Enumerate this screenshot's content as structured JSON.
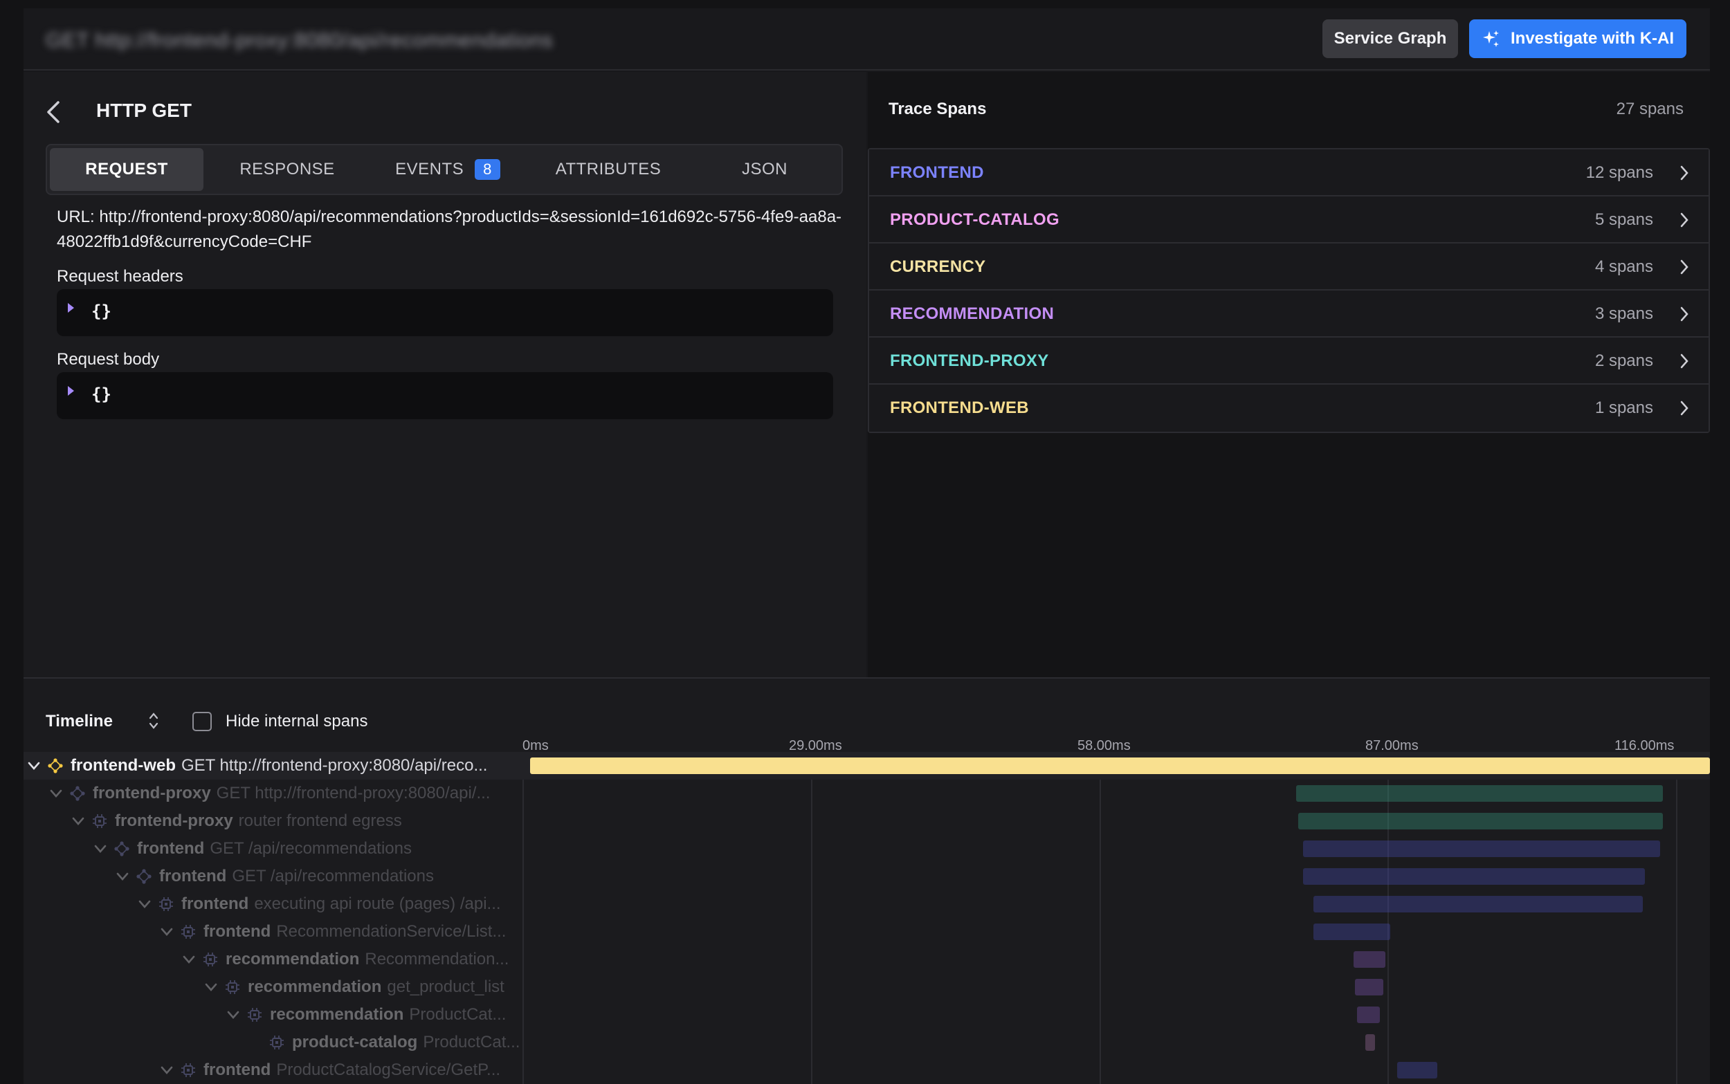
{
  "topbar": {
    "title": "GET http://frontend-proxy:8080/api/recommendations",
    "service_graph_label": "Service Graph",
    "investigate_label": "Investigate with K-AI",
    "accent_color": "#2f7cf6"
  },
  "detail": {
    "title": "HTTP GET",
    "tabs": [
      {
        "label": "REQUEST"
      },
      {
        "label": "RESPONSE"
      },
      {
        "label": "EVENTS",
        "count": "8"
      },
      {
        "label": "ATTRIBUTES"
      },
      {
        "label": "JSON"
      }
    ],
    "url_text": "URL: http://frontend-proxy:8080/api/recommendations?productIds=&sessionId=161d692c-5756-4fe9-aa8a-48022ffb1d9f&currencyCode=CHF",
    "request_headers_label": "Request headers",
    "request_headers_value": "{}",
    "request_body_label": "Request body",
    "request_body_value": "{}"
  },
  "trace_spans": {
    "title": "Trace Spans",
    "total": "27 spans",
    "services": [
      {
        "name": "FRONTEND",
        "count": "12 spans",
        "color": "#7c83ff"
      },
      {
        "name": "PRODUCT-CATALOG",
        "count": "5 spans",
        "color": "#f0a0f0"
      },
      {
        "name": "CURRENCY",
        "count": "4 spans",
        "color": "#f4e3a4"
      },
      {
        "name": "RECOMMENDATION",
        "count": "3 spans",
        "color": "#c48ef5"
      },
      {
        "name": "FRONTEND-PROXY",
        "count": "2 spans",
        "color": "#6fe0d8"
      },
      {
        "name": "FRONTEND-WEB",
        "count": "1 spans",
        "color": "#f6dc8e"
      }
    ]
  },
  "timeline": {
    "title": "Timeline",
    "hide_internal_label": "Hide internal spans",
    "ticks": [
      "0ms",
      "29.00ms",
      "58.00ms",
      "87.00ms",
      "116.00ms"
    ],
    "spans": [
      {
        "service": "frontend-web",
        "op": "GET http://frontend-proxy:8080/api/reco...",
        "depth": 0,
        "color": "#f9e08f",
        "start": 0.0,
        "end": 1.0,
        "icon": "network-icon",
        "chevron": true
      },
      {
        "service": "frontend-proxy",
        "op": "GET http://frontend-proxy:8080/api/...",
        "depth": 1,
        "color": "#3aa88a",
        "start": 0.649,
        "end": 0.96,
        "icon": "network-icon",
        "chevron": true
      },
      {
        "service": "frontend-proxy",
        "op": "router frontend egress",
        "depth": 2,
        "color": "#3aa88a",
        "start": 0.651,
        "end": 0.96,
        "icon": "chip-icon",
        "chevron": true
      },
      {
        "service": "frontend",
        "op": "GET /api/recommendations",
        "depth": 3,
        "color": "#4a4fbf",
        "start": 0.655,
        "end": 0.958,
        "icon": "network-icon",
        "chevron": true
      },
      {
        "service": "frontend",
        "op": "GET /api/recommendations",
        "depth": 4,
        "color": "#4a4fbf",
        "start": 0.655,
        "end": 0.945,
        "icon": "network-icon",
        "chevron": true
      },
      {
        "service": "frontend",
        "op": "executing api route (pages) /api...",
        "depth": 5,
        "color": "#4a4fbf",
        "start": 0.664,
        "end": 0.943,
        "icon": "chip-icon",
        "chevron": true
      },
      {
        "service": "frontend",
        "op": "RecommendationService/List...",
        "depth": 6,
        "color": "#4a4fbf",
        "start": 0.664,
        "end": 0.729,
        "icon": "chip-icon",
        "chevron": true
      },
      {
        "service": "recommendation",
        "op": "Recommendation...",
        "depth": 7,
        "color": "#8a5bc4",
        "start": 0.698,
        "end": 0.725,
        "icon": "chip-icon",
        "chevron": true
      },
      {
        "service": "recommendation",
        "op": "get_product_list",
        "depth": 8,
        "color": "#8a5bc4",
        "start": 0.699,
        "end": 0.723,
        "icon": "chip-icon",
        "chevron": true
      },
      {
        "service": "recommendation",
        "op": "ProductCat...",
        "depth": 9,
        "color": "#8a5bc4",
        "start": 0.701,
        "end": 0.72,
        "icon": "chip-icon",
        "chevron": true
      },
      {
        "service": "product-catalog",
        "op": "ProductCat...",
        "depth": 10,
        "color": "#b07ab0",
        "start": 0.708,
        "end": 0.716,
        "icon": "chip-icon",
        "chevron": false
      },
      {
        "service": "frontend",
        "op": "ProductCatalogService/GetP...",
        "depth": 6,
        "color": "#4a4fbf",
        "start": 0.735,
        "end": 0.769,
        "icon": "chip-icon",
        "chevron": true
      }
    ]
  }
}
